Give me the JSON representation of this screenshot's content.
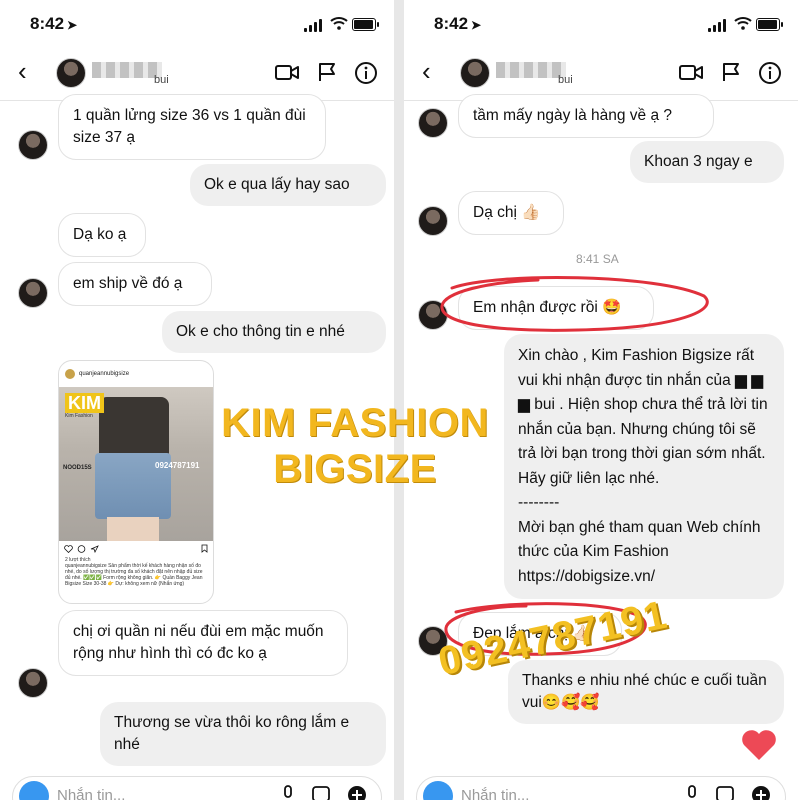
{
  "left": {
    "status": {
      "time": "8:42"
    },
    "header": {
      "name_suffix": "bui"
    },
    "messages": [
      {
        "dir": "in",
        "text": "1 quần lửng size 36 vs 1 quần đùi size 37 ạ"
      },
      {
        "dir": "out",
        "text": "Ok e  qua lấy hay sao"
      },
      {
        "dir": "in",
        "text": "Dạ ko ạ"
      },
      {
        "dir": "in",
        "text": "em ship về đó ạ"
      },
      {
        "dir": "out",
        "text": "Ok e cho thông tin e nhé"
      },
      {
        "dir": "in",
        "text": "chị ơi quần ni nếu đùi em mặc muốn rộng như hình thì có đc ko ạ"
      },
      {
        "dir": "out",
        "text": "Thương se vừa thôi ko rông lắm e nhé"
      }
    ],
    "post": {
      "account": "quanjeannubigsize",
      "brand": "KIM",
      "brand_sub": "Kim Fashion",
      "code": "NOOD15S",
      "phone": "0924787191",
      "likes": "2 lượt thích",
      "caption": "quanjeannubigsize Sản phẩm thời kế khách hàng nhận số đo nhé, do số lượng thị trường đa số khách đặt nên nhập đủ size đủ nhé. ✅✅✅ Form rộng không giãn. 👉 Quần Baggy Jean Bigsize Size 30-38 👉 Dự: không xem nữ (Nhắn ứng)"
    },
    "composer": {
      "placeholder": "Nhắn tin..."
    }
  },
  "right": {
    "status": {
      "time": "8:42"
    },
    "header": {
      "name_suffix": "bui"
    },
    "messages": [
      {
        "dir": "in",
        "text": "tầm mấy ngày là hàng về ạ ?"
      },
      {
        "dir": "out",
        "text": "Khoan 3 ngay e"
      },
      {
        "dir": "in",
        "text": "Dạ chị 👍🏻"
      },
      {
        "dir": "time",
        "text": "8:41 SA"
      },
      {
        "dir": "in",
        "text": "Em nhận được rồi 🤩"
      },
      {
        "dir": "out",
        "text": "Xin chào , Kim Fashion Bigsize rất vui khi nhận được tin nhắn của ▆ ▆ ▆ bui . Hiện shop chưa thể trả lời tin nhắn của bạn. Nhưng chúng tôi sẽ trả lời bạn trong thời gian sớm nhất. Hãy giữ liên lạc nhé.\n--------\nMời bạn ghé tham quan Web chính thức của Kim Fashion https://dobigsize.vn/"
      },
      {
        "dir": "in",
        "text": "Đẹp lắm á chị 👍🏻"
      },
      {
        "dir": "out",
        "text": "Thanks e nhiu nhé chúc e cuối tuần vui😊🥰🥰"
      }
    ],
    "composer": {
      "placeholder": "Nhắn tin..."
    }
  },
  "watermarks": {
    "brand_line1": "KIM FASHION",
    "brand_line2": "BIGSIZE",
    "phone": "0924787191"
  },
  "colors": {
    "accent_blue": "#3897f0",
    "heart_red": "#ed4956",
    "watermark_gold": "#f2b71f",
    "highlight_red": "#e0303b"
  }
}
